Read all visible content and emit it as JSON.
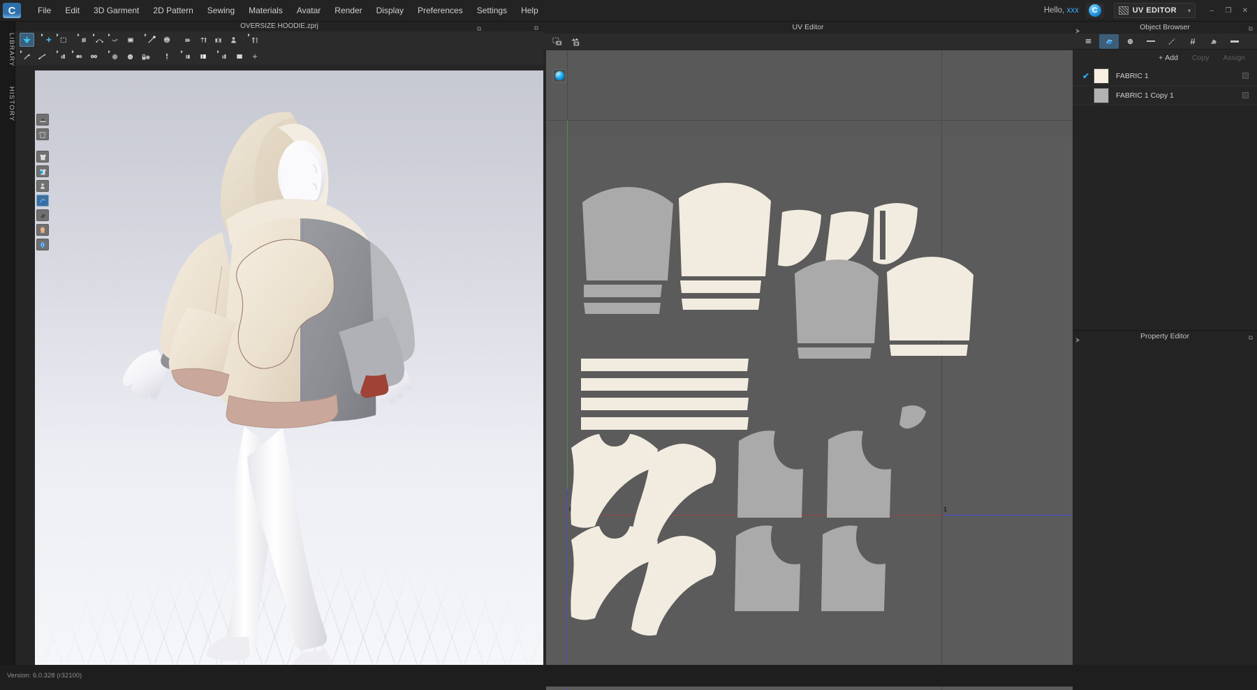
{
  "app": {
    "logo_letter": "C",
    "title": "OVERSIZE HOODIE.zprj",
    "version": "Version: 6.0.328 (r32100)"
  },
  "menubar": {
    "items": [
      {
        "label": "File"
      },
      {
        "label": "Edit"
      },
      {
        "label": "3D Garment"
      },
      {
        "label": "2D Pattern"
      },
      {
        "label": "Sewing"
      },
      {
        "label": "Materials"
      },
      {
        "label": "Avatar"
      },
      {
        "label": "Render"
      },
      {
        "label": "Display"
      },
      {
        "label": "Preferences"
      },
      {
        "label": "Settings"
      },
      {
        "label": "Help"
      }
    ],
    "greeting_prefix": "Hello, ",
    "greeting_user": "xxx",
    "cloud_icon": "cloud-icon",
    "cloud_letter": "C",
    "mode_label": "UV EDITOR",
    "mode_caret": "▾",
    "window_controls": [
      {
        "name": "minimize-button",
        "glyph": "–"
      },
      {
        "name": "maximize-button",
        "glyph": "❐"
      },
      {
        "name": "close-button",
        "glyph": "✕"
      }
    ]
  },
  "left_tabs": [
    {
      "label": "LIBRARY",
      "name": "sidebar-tab-library"
    },
    {
      "label": "HISTORY",
      "name": "sidebar-tab-history"
    }
  ],
  "viewport3d": {
    "title": "OVERSIZE HOODIE.zprj",
    "expand_glyph": "⧉",
    "toolbar_row1": [
      {
        "name": "select-mesh-tool",
        "selected": true
      },
      {
        "name": "transform-pattern-tool",
        "selected": false
      },
      {
        "name": "select-box-tool",
        "selected": false
      },
      {
        "name": "fold-arrange-tool",
        "selected": false
      },
      {
        "name": "pin-tool",
        "selected": false
      },
      {
        "name": "tack-tool",
        "selected": false
      },
      {
        "name": "show-pattern-tool",
        "selected": false
      },
      {
        "name": "segment-sewing-tool",
        "selected": false
      },
      {
        "name": "free-sewing-tool",
        "selected": false
      },
      {
        "name": "flip-tool",
        "selected": false
      },
      {
        "name": "symmetric-pattern-tool",
        "selected": false
      },
      {
        "name": "mirror-tool",
        "selected": false
      },
      {
        "name": "avatar-tool",
        "selected": false
      },
      {
        "name": "garment-fit-tool",
        "selected": false
      }
    ],
    "toolbar_row2": [
      {
        "name": "zipper-tool"
      },
      {
        "name": "trim-tool"
      },
      {
        "name": "graded-pattern-tool"
      },
      {
        "name": "button-tool"
      },
      {
        "name": "buttonhole-tool"
      },
      {
        "name": "button-head-tool"
      },
      {
        "name": "button-round-tool"
      },
      {
        "name": "lock-button-tool"
      },
      {
        "name": "topstitch-tool"
      },
      {
        "name": "fold-tool"
      },
      {
        "name": "fabric-panel-tool"
      },
      {
        "name": "bias-tool"
      },
      {
        "name": "fabric-block-tool"
      },
      {
        "name": "add-more-tool"
      }
    ],
    "side_icons": [
      {
        "name": "fabric-roll-icon",
        "active": false
      },
      {
        "name": "garment-tshirt-icon",
        "active": false
      },
      {
        "name": "garment-layers-icon",
        "active": false
      },
      {
        "name": "garment-color-icon",
        "active": false
      },
      {
        "name": "avatar-pin-icon",
        "active": false
      },
      {
        "name": "fabric-texture-icon",
        "active": true
      },
      {
        "name": "fabric-drape-icon",
        "active": false
      },
      {
        "name": "skin-tone-icon",
        "active": false
      },
      {
        "name": "environment-globe-icon",
        "active": false
      }
    ],
    "garment": {
      "shell_color": "#efe7d7",
      "panel_color": "#8f9196",
      "rib_color": "#c9a79b",
      "rib_accent": "#a8463a",
      "skin_color": "#fbfbfd"
    }
  },
  "uv_editor": {
    "title": "UV Editor",
    "expand_glyph": "⧉",
    "toolbar": [
      {
        "name": "uv-snapshot-icon"
      },
      {
        "name": "uv-capture-icon"
      }
    ],
    "gizmo_icon": "uv-navigation-ball-icon",
    "origin_label": "0",
    "unit_label": "1",
    "canvas_bg": "#5b5b5b",
    "axis_colors": {
      "u_axis": "#9a4545",
      "v_axis": "#4b8f4b",
      "boundary": "#4a4ad0"
    },
    "fabric_fill_primary": "#f2ece0",
    "fabric_fill_secondary": "#aaaaaa"
  },
  "object_browser": {
    "title": "Object Browser",
    "pin_glyph": "⮞",
    "expand_glyph": "⧉",
    "tabs": [
      {
        "name": "ob-tab-list",
        "glyph": "list-icon",
        "selected": false
      },
      {
        "name": "ob-tab-fabric",
        "glyph": "fabric-icon",
        "selected": true
      },
      {
        "name": "ob-tab-button",
        "glyph": "button-icon",
        "selected": false
      },
      {
        "name": "ob-tab-tape",
        "glyph": "tape-icon",
        "selected": false
      },
      {
        "name": "ob-tab-topstitch",
        "glyph": "topstitch-icon",
        "selected": false
      },
      {
        "name": "ob-tab-zipper",
        "glyph": "zipper-icon",
        "selected": false
      },
      {
        "name": "ob-tab-trim",
        "glyph": "trim-icon",
        "selected": false
      },
      {
        "name": "ob-tab-fold",
        "glyph": "fold-icon",
        "selected": false
      }
    ],
    "actions": [
      {
        "name": "add-button",
        "label": "Add",
        "prefix": "+",
        "disabled": false
      },
      {
        "name": "copy-button",
        "label": "Copy",
        "disabled": true
      },
      {
        "name": "assign-button",
        "label": "Assign",
        "disabled": true
      }
    ],
    "rows": [
      {
        "checked": true,
        "check_glyph": "✔",
        "swatch": "#f6efe2",
        "name": "FABRIC 1"
      },
      {
        "checked": false,
        "check_glyph": "",
        "swatch": "#b3b3b3",
        "name": "FABRIC 1 Copy 1"
      }
    ]
  },
  "property_editor": {
    "title": "Property Editor",
    "pin_glyph": "⮞",
    "expand_glyph": "⧉"
  }
}
